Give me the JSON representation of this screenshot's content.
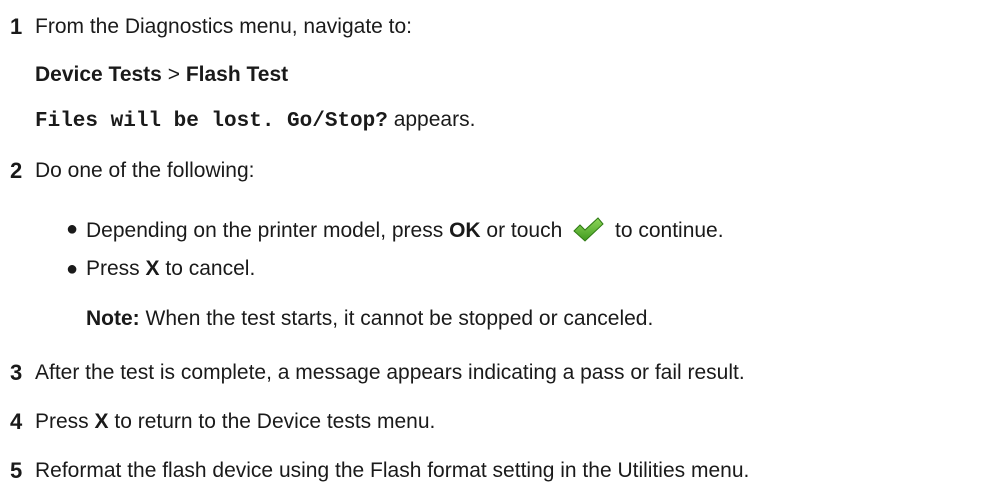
{
  "steps": [
    {
      "number": "1",
      "text": "From the Diagnostics menu, navigate to:",
      "path_part1": "Device Tests",
      "path_sep": ">",
      "path_part2": "Flash Test",
      "message": "Files will be lost. Go/Stop?",
      "message_suffix": "appears."
    },
    {
      "number": "2",
      "text": "Do one of the following:",
      "bullets": [
        {
          "pre": "Depending on the printer model, press",
          "bold": "OK",
          "mid": "or touch",
          "post": "to continue.",
          "icon": "checkmark-icon"
        },
        {
          "pre": "Press",
          "bold": "X",
          "post": "to cancel."
        }
      ],
      "note_label": "Note:",
      "note_text": "When the test starts, it cannot be stopped or canceled."
    },
    {
      "number": "3",
      "text": "After the test is complete, a message appears indicating a pass or fail result."
    },
    {
      "number": "4",
      "pre": "Press",
      "bold": "X",
      "post": "to return to the Device tests menu."
    },
    {
      "number": "5",
      "text": "Reformat the flash device using the Flash format setting in the Utilities menu."
    }
  ],
  "colors": {
    "text": "#1a1a1a",
    "check_green": "#5cb531"
  }
}
